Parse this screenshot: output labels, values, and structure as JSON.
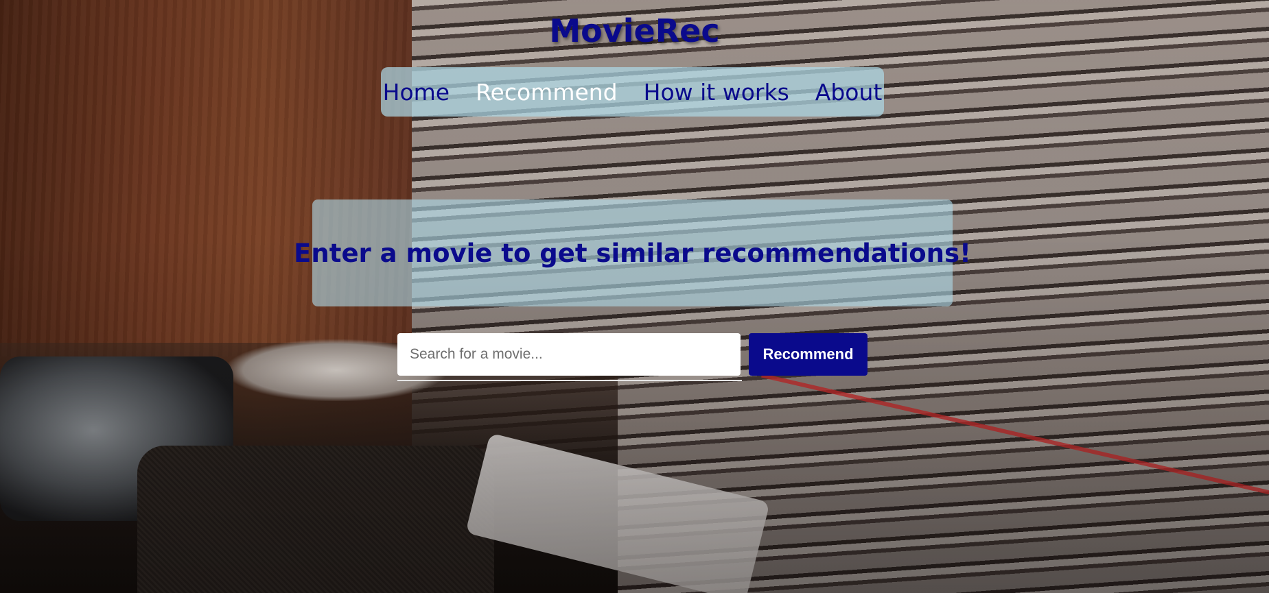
{
  "site": {
    "title": "MovieRec"
  },
  "nav": {
    "items": [
      {
        "label": "Home",
        "active": false
      },
      {
        "label": "Recommend",
        "active": true
      },
      {
        "label": "How it works",
        "active": false
      },
      {
        "label": "About",
        "active": false
      }
    ]
  },
  "hero": {
    "heading": "Enter a movie to get similar recommendations!"
  },
  "search": {
    "placeholder": "Search for a movie...",
    "value": "",
    "button_label": "Recommend"
  },
  "colors": {
    "brand_navy": "#0a0a8c",
    "panel_light_blue": "#add8e6",
    "active_nav_text": "#ffffff"
  }
}
